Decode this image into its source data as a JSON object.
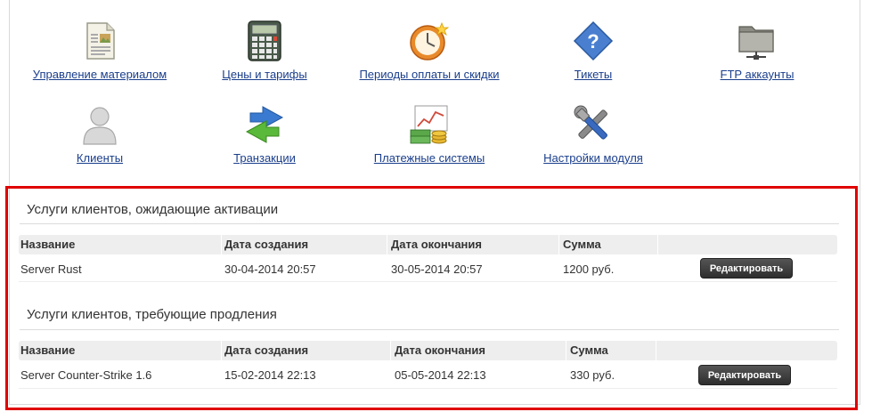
{
  "modules": [
    {
      "label": "Управление материалом",
      "icon": "document-icon"
    },
    {
      "label": "Цены и тарифы",
      "icon": "calculator-icon"
    },
    {
      "label": "Периоды оплаты и скидки",
      "icon": "clock-icon"
    },
    {
      "label": "Тикеты",
      "icon": "help-icon"
    },
    {
      "label": "FTP аккаунты",
      "icon": "network-folder-icon"
    },
    {
      "label": "Клиенты",
      "icon": "user-icon"
    },
    {
      "label": "Транзакции",
      "icon": "transfer-arrows-icon"
    },
    {
      "label": "Платежные системы",
      "icon": "money-chart-icon"
    },
    {
      "label": "Настройки модуля",
      "icon": "tools-icon"
    }
  ],
  "pending": {
    "title": "Услуги клиентов, ожидающие активации",
    "columns": [
      "Название",
      "Дата создания",
      "Дата окончания",
      "Сумма"
    ],
    "rows": [
      {
        "name": "Server Rust",
        "created": "30-04-2014 20:57",
        "expires": "30-05-2014 20:57",
        "sum": "1200 руб.",
        "action": "Редактировать"
      }
    ]
  },
  "renewal": {
    "title": "Услуги клиентов, требующие продления",
    "columns": [
      "Название",
      "Дата создания",
      "Дата окончания",
      "Сумма"
    ],
    "rows": [
      {
        "name": "Server Counter-Strike 1.6",
        "created": "15-02-2014 22:13",
        "expires": "05-05-2014 22:13",
        "sum": "330 руб.",
        "action": "Редактировать"
      }
    ]
  },
  "colors": {
    "highlight": "#e00000",
    "link": "#1a3e8c",
    "button": "#333333"
  }
}
